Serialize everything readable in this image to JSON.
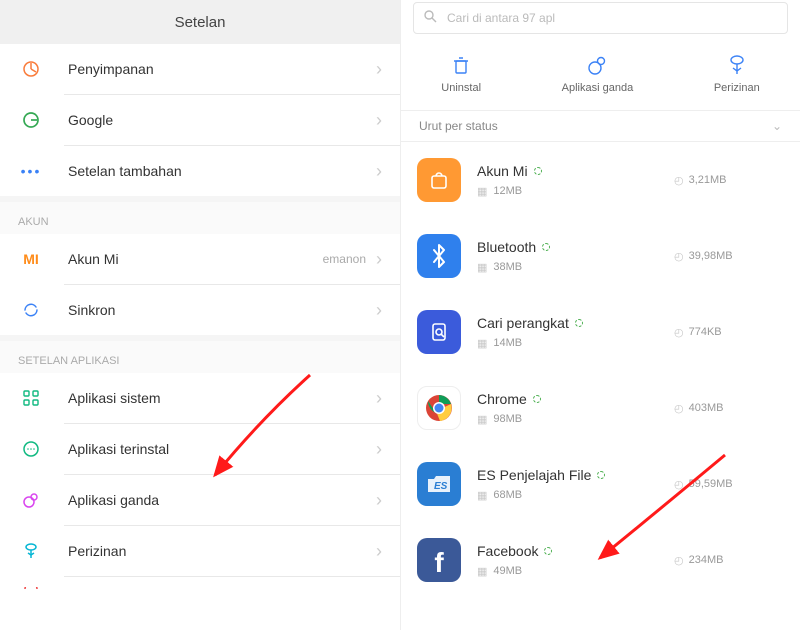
{
  "left": {
    "title": "Setelan",
    "items": [
      {
        "label": "Penyimpanan"
      },
      {
        "label": "Google"
      },
      {
        "label": "Setelan tambahan"
      }
    ],
    "section_account": "AKUN",
    "account_items": [
      {
        "label": "Akun Mi",
        "detail": "emanon"
      },
      {
        "label": "Sinkron"
      }
    ],
    "section_apps": "SETELAN APLIKASI",
    "app_settings": [
      {
        "label": "Aplikasi sistem"
      },
      {
        "label": "Aplikasi terinstal"
      },
      {
        "label": "Aplikasi ganda"
      },
      {
        "label": "Perizinan"
      }
    ]
  },
  "right": {
    "search_placeholder": "Cari di antara 97 apl",
    "actions": {
      "uninstall": "Uninstal",
      "dual": "Aplikasi ganda",
      "perm": "Perizinan"
    },
    "sort_label": "Urut per status",
    "apps": [
      {
        "name": "Akun Mi",
        "ram": "12MB",
        "storage": "3,21MB"
      },
      {
        "name": "Bluetooth",
        "ram": "38MB",
        "storage": "39,98MB"
      },
      {
        "name": "Cari perangkat",
        "ram": "14MB",
        "storage": "774KB"
      },
      {
        "name": "Chrome",
        "ram": "98MB",
        "storage": "403MB"
      },
      {
        "name": "ES Penjelajah File",
        "ram": "68MB",
        "storage": "59,59MB"
      },
      {
        "name": "Facebook",
        "ram": "49MB",
        "storage": "234MB"
      }
    ]
  }
}
